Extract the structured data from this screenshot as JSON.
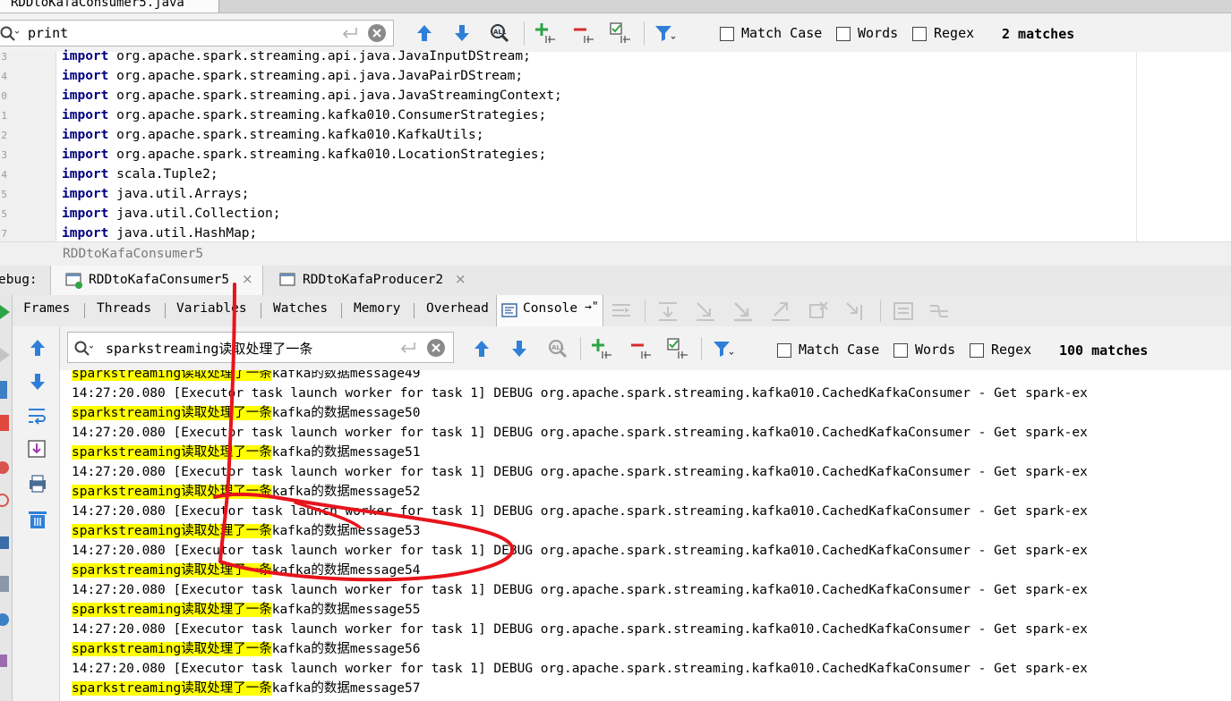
{
  "editor_tab": {
    "title": "RDDtoKafaConsumer5.java"
  },
  "editor_search": {
    "query": "print",
    "match_case_label": "Match Case",
    "words_label": "Words",
    "regex_label": "Regex",
    "match_count": "2 matches"
  },
  "editor": {
    "line_numbers": [
      "3",
      "4",
      "0",
      "1",
      "2",
      "3",
      "4",
      "5",
      "5",
      "7"
    ],
    "lines": [
      {
        "kw": "import",
        "rest": " org.apache.spark.streaming.api.java.JavaInputDStream;"
      },
      {
        "kw": "import",
        "rest": " org.apache.spark.streaming.api.java.JavaPairDStream;"
      },
      {
        "kw": "import",
        "rest": " org.apache.spark.streaming.api.java.JavaStreamingContext;"
      },
      {
        "kw": "import",
        "rest": " org.apache.spark.streaming.kafka010.ConsumerStrategies;"
      },
      {
        "kw": "import",
        "rest": " org.apache.spark.streaming.kafka010.KafkaUtils;"
      },
      {
        "kw": "import",
        "rest": " org.apache.spark.streaming.kafka010.LocationStrategies;"
      },
      {
        "kw": "import",
        "rest": " scala.Tuple2;"
      },
      {
        "kw": "import",
        "rest": " java.util.Arrays;"
      },
      {
        "kw": "import",
        "rest": " java.util.Collection;"
      },
      {
        "kw": "import",
        "rest": " java.util.HashMap;"
      }
    ],
    "breadcrumb": "RDDtoKafaConsumer5"
  },
  "debug": {
    "label": "ebug:",
    "tabs": [
      {
        "label": "RDDtoKafaConsumer5"
      },
      {
        "label": "RDDtoKafaProducer2"
      }
    ],
    "close_glyph": "×",
    "subtabs": [
      "Frames",
      "Threads",
      "Variables",
      "Watches",
      "Memory",
      "Overhead",
      "Console"
    ],
    "console_pin": "→\""
  },
  "console_search": {
    "query": "sparkstreaming读取处理了一条",
    "match_case_label": "Match Case",
    "words_label": "Words",
    "regex_label": "Regex",
    "match_count": "100 matches"
  },
  "console": {
    "lines": [
      {
        "hl": "sparkstreaming读取处理了一条",
        "rest": "kafka的数据message49"
      },
      {
        "hl": "",
        "rest": "14:27:20.080 [Executor task launch worker for task 1] DEBUG org.apache.spark.streaming.kafka010.CachedKafkaConsumer - Get spark-ex"
      },
      {
        "hl": "sparkstreaming读取处理了一条",
        "rest": "kafka的数据message50"
      },
      {
        "hl": "",
        "rest": "14:27:20.080 [Executor task launch worker for task 1] DEBUG org.apache.spark.streaming.kafka010.CachedKafkaConsumer - Get spark-ex"
      },
      {
        "hl": "sparkstreaming读取处理了一条",
        "rest": "kafka的数据message51"
      },
      {
        "hl": "",
        "rest": "14:27:20.080 [Executor task launch worker for task 1] DEBUG org.apache.spark.streaming.kafka010.CachedKafkaConsumer - Get spark-ex"
      },
      {
        "hl": "sparkstreaming读取处理了一条",
        "rest": "kafka的数据message52"
      },
      {
        "hl": "",
        "rest": "14:27:20.080 [Executor task launch worker for task 1] DEBUG org.apache.spark.streaming.kafka010.CachedKafkaConsumer - Get spark-ex"
      },
      {
        "hl": "sparkstreaming读取处理了一条",
        "rest": "kafka的数据message53"
      },
      {
        "hl": "",
        "rest": "14:27:20.080 [Executor task launch worker for task 1] DEBUG org.apache.spark.streaming.kafka010.CachedKafkaConsumer - Get spark-ex"
      },
      {
        "hl": "sparkstreaming读取处理了一条",
        "rest": "kafka的数据message54"
      },
      {
        "hl": "",
        "rest": "14:27:20.080 [Executor task launch worker for task 1] DEBUG org.apache.spark.streaming.kafka010.CachedKafkaConsumer - Get spark-ex"
      },
      {
        "hl": "sparkstreaming读取处理了一条",
        "rest": "kafka的数据message55"
      },
      {
        "hl": "",
        "rest": "14:27:20.080 [Executor task launch worker for task 1] DEBUG org.apache.spark.streaming.kafka010.CachedKafkaConsumer - Get spark-ex"
      },
      {
        "hl": "sparkstreaming读取处理了一条",
        "rest": "kafka的数据message56"
      },
      {
        "hl": "",
        "rest": "14:27:20.080 [Executor task launch worker for task 1] DEBUG org.apache.spark.streaming.kafka010.CachedKafkaConsumer - Get spark-ex"
      },
      {
        "hl": "sparkstreaming读取处理了一条",
        "rest": "kafka的数据message57"
      }
    ]
  },
  "colors": {
    "highlight": "#ffff00",
    "keyword": "#000080",
    "annotation": "#e8141c",
    "accent_blue": "#2f7fd8"
  },
  "icons": {
    "search": "magnifier-icon",
    "clear": "clear-circle-icon",
    "prev": "arrow-up-icon",
    "next": "arrow-down-icon",
    "find_all": "find-all-icon",
    "add_occurrence": "add-selection-icon",
    "remove_occurrence": "remove-selection-icon",
    "select_all": "select-all-occurrences-icon",
    "filter": "filter-icon"
  }
}
